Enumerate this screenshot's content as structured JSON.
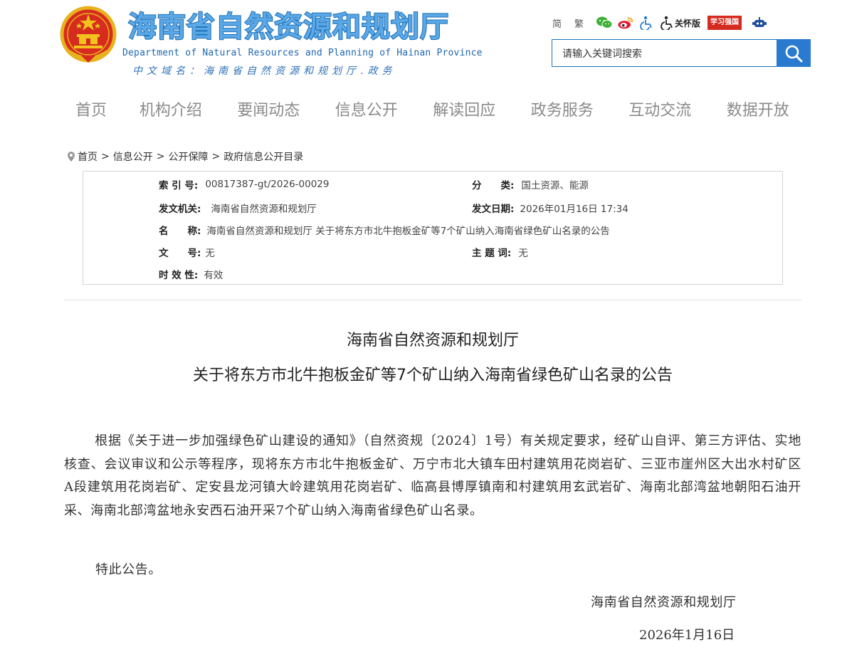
{
  "header": {
    "title": "海南省自然资源和规划厅",
    "title_en": "Department of Natural Resources and Planning of Hainan Province",
    "domain": "中文域名：海南省自然资源和规划厅.政务"
  },
  "tools": {
    "simplified": "简",
    "traditional": "繁",
    "care_mode": "关怀版",
    "xuexi": "学习强国"
  },
  "search": {
    "placeholder": "请输入关键词搜索"
  },
  "nav": [
    "首页",
    "机构介绍",
    "要闻动态",
    "信息公开",
    "解读回应",
    "政务服务",
    "互动交流",
    "数据开放"
  ],
  "breadcrumb": [
    "首页",
    "信息公开",
    "公开保障",
    "政府信息公开目录"
  ],
  "info": {
    "index_label": "索 引 号:",
    "index_value": "00817387-gt/2026-00029",
    "category_label": "分　　类:",
    "category_value": "国土资源、能源",
    "issuer_label": "发文机关:",
    "issuer_value": "海南省自然资源和规划厅",
    "date_label": "发文日期:",
    "date_value": "2026年01月16日 17:34",
    "name_label": "名　　称:",
    "name_value": "海南省自然资源和规划厅 关于将东方市北牛抱板金矿等7个矿山纳入海南省绿色矿山名录的公告",
    "docno_label": "文　　号:",
    "docno_value": "无",
    "subject_label": "主 题 词:",
    "subject_value": "无",
    "validity_label": "时 效 性:",
    "validity_value": "有效"
  },
  "article": {
    "title_line1": "海南省自然资源和规划厅",
    "title_line2": "关于将东方市北牛抱板金矿等7个矿山纳入海南省绿色矿山名录的公告",
    "body": "根据《关于进一步加强绿色矿山建设的通知》（自然资规〔2024〕1号）有关规定要求，经矿山自评、第三方评估、实地核查、会议审议和公示等程序，现将东方市北牛抱板金矿、万宁市北大镇车田村建筑用花岗岩矿、三亚市崖州区大出水村矿区A段建筑用花岗岩矿、定安县龙河镇大岭建筑用花岗岩矿、临高县博厚镇南和村建筑用玄武岩矿、海南北部湾盆地朝阳石油开采、海南北部湾盆地永安西石油开采7个矿山纳入海南省绿色矿山名录。",
    "note": "特此公告。",
    "signature": "海南省自然资源和规划厅",
    "date": "2026年1月16日"
  },
  "colors": {
    "brand_blue": "#1e6fb8",
    "search_blue": "#2a7bd0",
    "xuexi_red": "#d42a1f"
  }
}
